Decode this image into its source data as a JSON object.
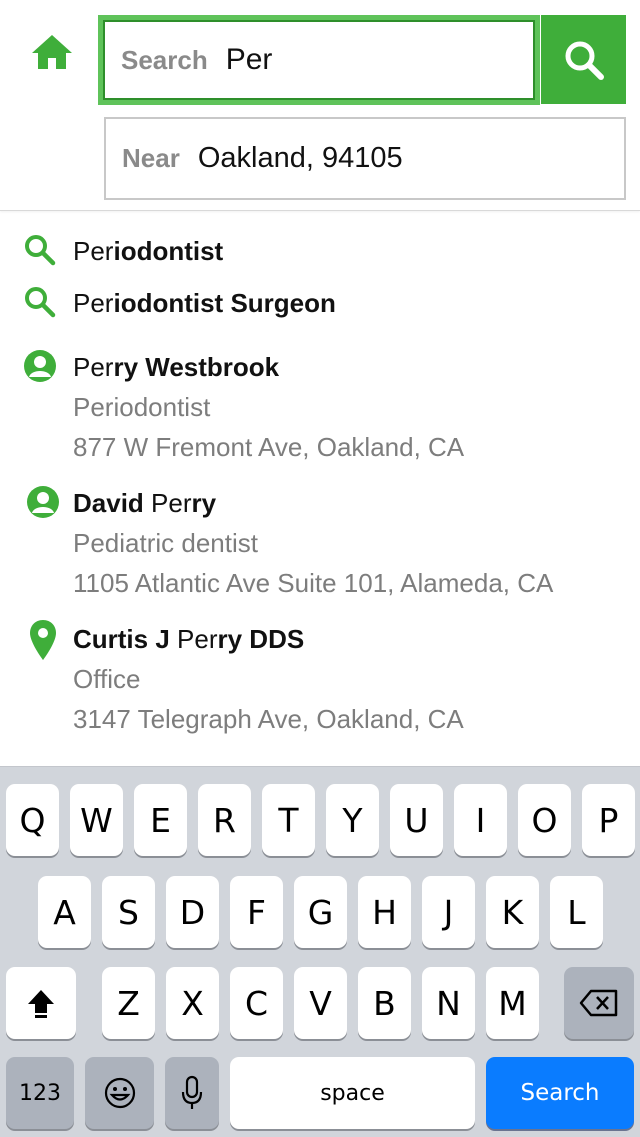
{
  "header": {
    "home_icon": "home-icon",
    "search": {
      "prefix": "Search",
      "value": "Per"
    },
    "search_button_icon": "search-icon",
    "near": {
      "prefix": "Near",
      "value": "Oakland, 94105"
    },
    "accent_color": "#3fae3a"
  },
  "suggestions": [
    {
      "type": "search",
      "icon": "search-icon",
      "match": "Per",
      "rest": "iodontist"
    },
    {
      "type": "search",
      "icon": "search-icon",
      "match": "Per",
      "rest": "iodontist Surgeon"
    },
    {
      "type": "person",
      "icon": "person-icon",
      "pre": "",
      "match": "Per",
      "rest": "ry Westbrook",
      "line1": "Periodontist",
      "line2": "877 W Fremont Ave, Oakland, CA"
    },
    {
      "type": "person",
      "icon": "person-icon",
      "pre": "David ",
      "match": "Per",
      "rest": "ry",
      "line1": "Pediatric dentist",
      "line2": "1105 Atlantic Ave Suite 101, Alameda, CA"
    },
    {
      "type": "place",
      "icon": "map-pin-icon",
      "pre": "Curtis J ",
      "match": "Per",
      "rest": "ry DDS",
      "line1": "Office",
      "line2": "3147 Telegraph Ave, Oakland, CA"
    }
  ],
  "keyboard": {
    "row1": [
      "Q",
      "W",
      "E",
      "R",
      "T",
      "Y",
      "U",
      "I",
      "O",
      "P"
    ],
    "row2": [
      "A",
      "S",
      "D",
      "F",
      "G",
      "H",
      "J",
      "K",
      "L"
    ],
    "row3": [
      "Z",
      "X",
      "C",
      "V",
      "B",
      "N",
      "M"
    ],
    "numbers_label": "123",
    "space_label": "space",
    "search_label": "Search",
    "shift_icon": "shift-icon",
    "backspace_icon": "backspace-icon",
    "emoji_icon": "emoji-icon",
    "mic_icon": "microphone-icon"
  }
}
